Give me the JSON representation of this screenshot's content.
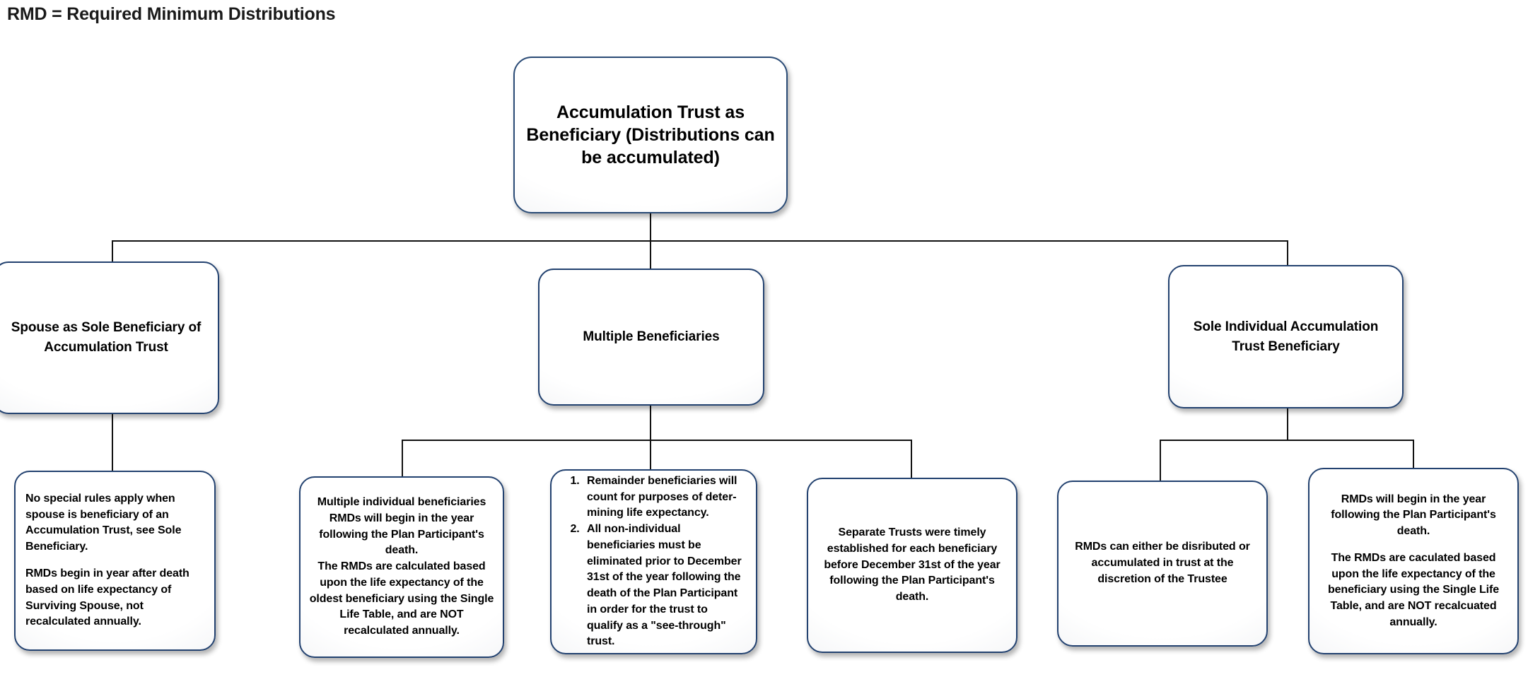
{
  "title": "RMD = Required Minimum Distributions",
  "colors": {
    "node_border": "#234270",
    "connector": "#111111",
    "text": "#000000",
    "background": "#ffffff"
  },
  "root": {
    "label": "Accumulation Trust as Beneficiary (Distributions can be accumulated)"
  },
  "branches": {
    "left": {
      "label": "Spouse as Sole Beneficiary of Accumulation  Trust",
      "child": {
        "para1": "No special rules apply when spouse is beneficiary of an Accumulation Trust, see Sole Beneficiary.",
        "para2": "RMDs begin in year after death based on life expectancy of Surviving Spouse, not recalculated annually."
      }
    },
    "middle": {
      "label": "Multiple Beneficiaries",
      "child1": {
        "para1": "Multiple individual beneficiaries RMDs will begin in the year following the Plan Participant's death.",
        "para2": "The RMDs are calculated based upon the life expectancy of the oldest beneficiary using the Single Life Table, and are NOT recalculated annually."
      },
      "child2": {
        "item1": "Remainder beneficiaries will count for purposes of deter-mining life expectancy.",
        "item2": "All non-individual beneficiaries must be eliminated prior to December 31st of the year following the death of the Plan Participant in order for the trust to qualify as a  \"see-through\" trust."
      },
      "child3": {
        "para1": "Separate Trusts were timely established for each beneficiary before December 31st of the year following the Plan Participant's death."
      }
    },
    "right": {
      "label": "Sole Individual  Accumulation Trust Beneficiary",
      "child1": {
        "para1": "RMDs can either be disributed or accumulated in trust at the discretion of the Trustee"
      },
      "child2": {
        "para1": "RMDs will begin in the year following the Plan Participant's death.",
        "para2": "The RMDs are caculated based upon the life expectancy of the beneficiary using the Single Life Table, and are NOT recalcuated annually."
      }
    }
  }
}
